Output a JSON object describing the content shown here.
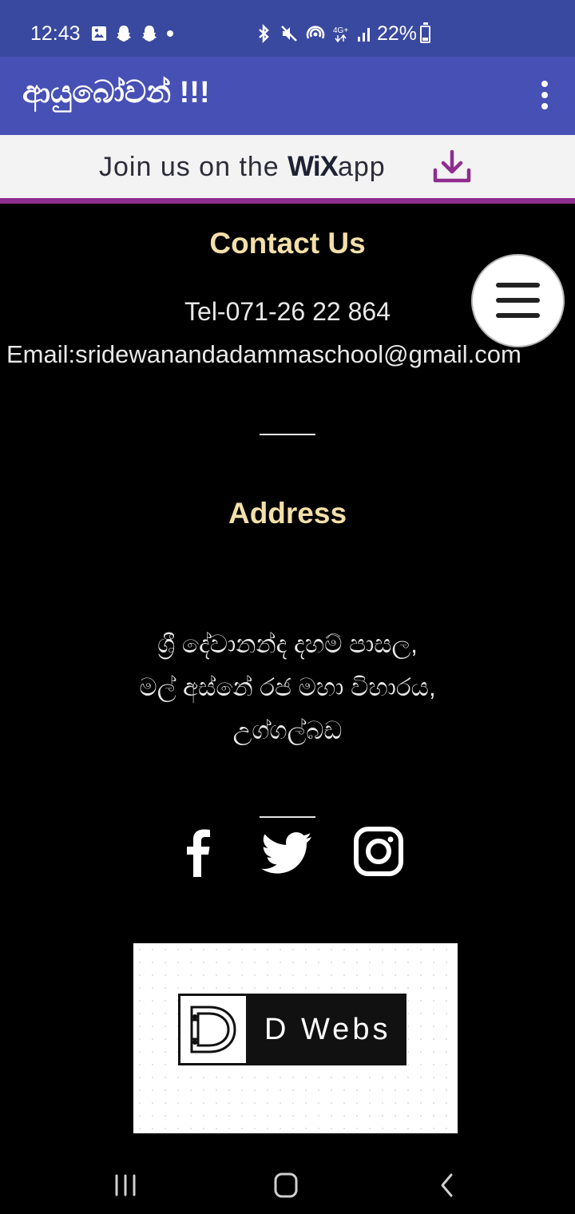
{
  "status_bar": {
    "time": "12:43",
    "battery": "22%",
    "battery_level": 0.22,
    "left_icons": [
      "gallery-icon",
      "snapchat-icon",
      "snapchat-icon",
      "dot-icon"
    ],
    "right_icons": [
      "bluetooth-icon",
      "mute-icon",
      "wifi-hotspot-icon",
      "4g-icon",
      "signal-icon",
      "battery-icon"
    ]
  },
  "app_bar": {
    "title": "ආයුබෝවන් !!!",
    "menu_icon": "more-vert-icon"
  },
  "banner": {
    "prefix": "Join us on the ",
    "brand": "WiX",
    "suffix": "app",
    "icon": "download-icon",
    "accent": "#8f2d8f"
  },
  "contact": {
    "heading": "Contact Us",
    "tel": "Tel-071-26 22 864",
    "email": "Email:sridewanandadammaschool@gmail.com"
  },
  "address": {
    "heading": "Address",
    "line1": "ශ්‍රී දේවානන්ද දහම් පාසල,",
    "line2": "මල් අස්නේ රජ මහා විහාරය,",
    "line3": "උග්ගල්බඩ"
  },
  "social": [
    "facebook-icon",
    "twitter-icon",
    "instagram-icon"
  ],
  "footer_logo": {
    "text": "D  Webs"
  },
  "colors": {
    "status_bar": "#3949a0",
    "app_bar": "#4750b5",
    "heading": "#f3dfa8",
    "page_bg": "#000000"
  },
  "nav": [
    "recents-icon",
    "home-icon",
    "back-icon"
  ]
}
